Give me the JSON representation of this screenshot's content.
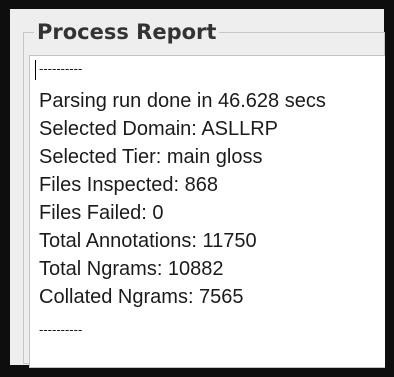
{
  "panel": {
    "title": "Process Report"
  },
  "report": {
    "separator_top": "----------",
    "lines": [
      "Parsing run done in 46.628 secs",
      "Selected Domain: ASLLRP",
      "Selected Tier: main gloss",
      "Files Inspected: 868",
      "Files Failed: 0",
      "Total Annotations: 11750",
      "Total Ngrams: 10882",
      "Collated Ngrams: 7565"
    ],
    "separator_bottom": "----------"
  }
}
